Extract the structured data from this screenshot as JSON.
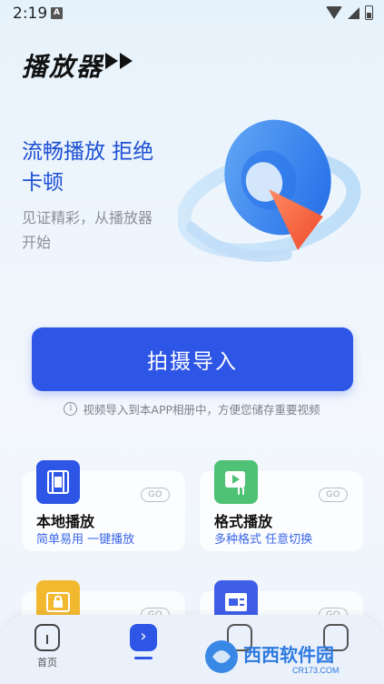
{
  "status_bar": {
    "time": "2:19",
    "notif_letter": "A"
  },
  "header": {
    "title": "播放器"
  },
  "hero": {
    "headline_line1": "流畅播放 拒绝",
    "headline_line2": "卡顿",
    "sub_line1": "见证精彩，从播放器",
    "sub_line2": "开始"
  },
  "primary": {
    "import_label": "拍摄导入",
    "hint_text": "视频导入到本APP相册中，方便您储存重要视频"
  },
  "cards": [
    {
      "title": "本地播放",
      "subtitle": "简单易用 一键播放",
      "badge": "GO",
      "icon": "film-icon",
      "color": "#2d55e6"
    },
    {
      "title": "格式播放",
      "subtitle": "多种格式 任意切换",
      "badge": "GO",
      "icon": "play-touch-icon",
      "color": "#4fc276"
    },
    {
      "title": "",
      "subtitle": "",
      "badge": "GO",
      "icon": "lock-image-icon",
      "color": "#f2b930"
    },
    {
      "title": "",
      "subtitle": "",
      "badge": "GO",
      "icon": "image-list-icon",
      "color": "#3f5ee8"
    }
  ],
  "bottom_nav": {
    "items": [
      {
        "label": "首页",
        "icon": "home-icon"
      },
      {
        "label": "",
        "icon": "play-chevron-icon"
      },
      {
        "label": "",
        "icon": "pen-icon"
      },
      {
        "label": "",
        "icon": "profile-icon"
      }
    ]
  },
  "watermark": {
    "text": "西西软件园",
    "url_text": "CR173.COM"
  },
  "colors": {
    "accent": "#2d55e6",
    "headline": "#1d4fd4",
    "card_sub": "#3a66e8"
  }
}
